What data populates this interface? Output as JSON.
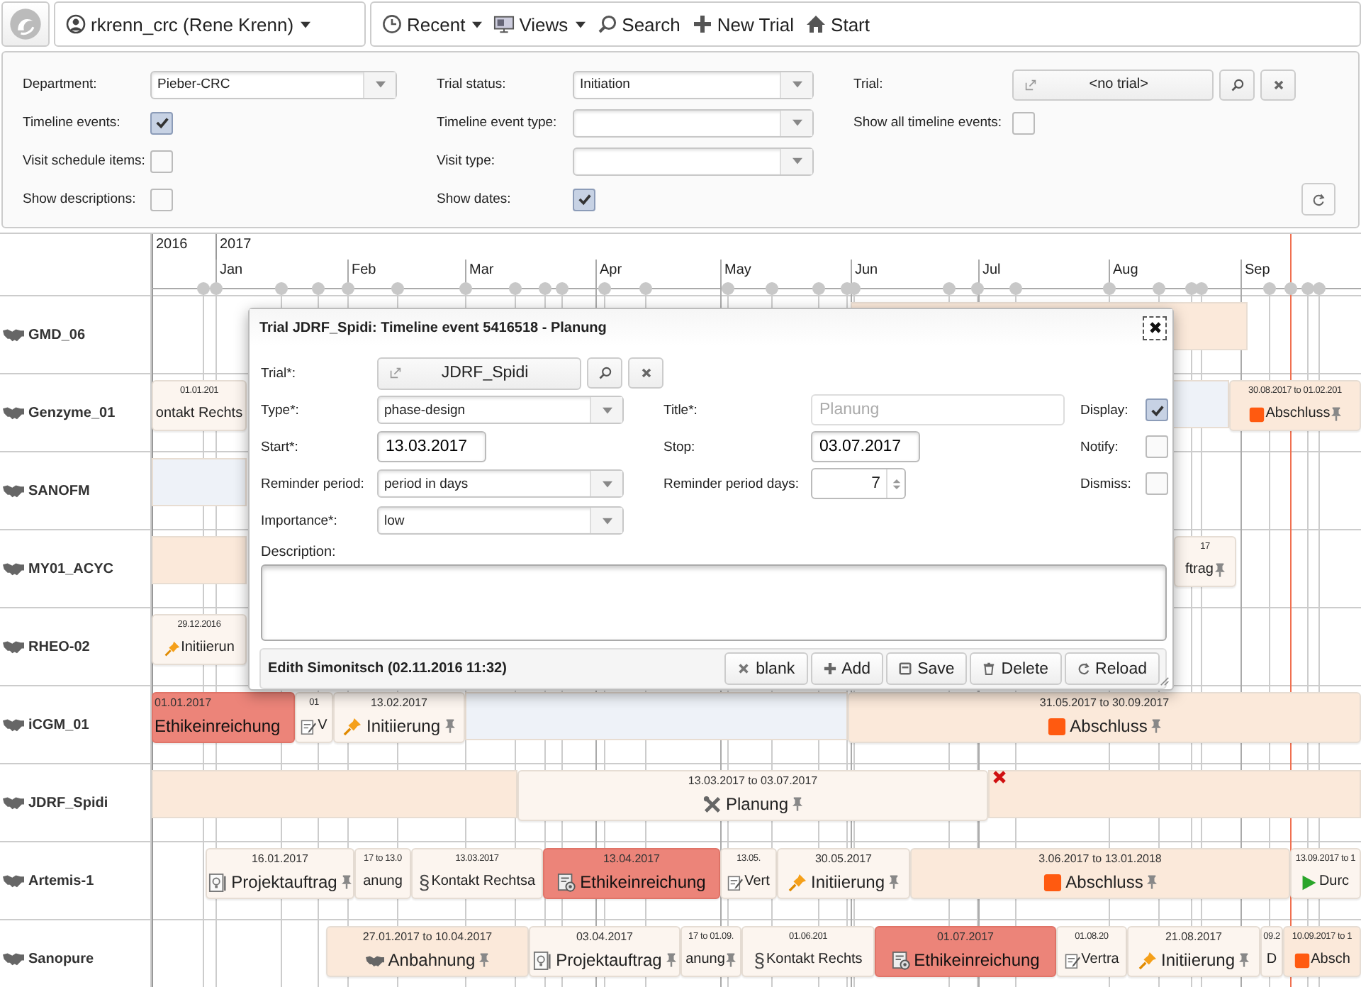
{
  "user_menu": {
    "label": "rkrenn_crc (Rene Krenn)"
  },
  "nav": [
    {
      "label": "Recent",
      "kind": "menu"
    },
    {
      "label": "Views",
      "kind": "menu"
    },
    {
      "label": "Search",
      "kind": "link"
    },
    {
      "label": "New Trial",
      "kind": "link"
    },
    {
      "label": "Start",
      "kind": "link"
    }
  ],
  "filter_columns": [
    [
      {
        "label": "Department:",
        "kind": "select",
        "value": "Pieber-CRC"
      },
      {
        "label": "Timeline events:",
        "kind": "checkbox",
        "checked": true
      },
      {
        "label": "Visit schedule items:",
        "kind": "checkbox",
        "checked": false
      },
      {
        "label": "Show descriptions:",
        "kind": "checkbox",
        "checked": false
      }
    ],
    [
      {
        "label": "Trial status:",
        "kind": "select",
        "value": "Initiation"
      },
      {
        "label": "Timeline event type:",
        "kind": "select"
      },
      {
        "label": "Visit type:",
        "kind": "select"
      },
      {
        "label": "Show dates:",
        "kind": "checkbox",
        "checked": true
      }
    ],
    [
      {
        "label": "Trial:",
        "kind": "lookup",
        "value": "<no trial>"
      },
      {
        "label": "Show all timeline events:",
        "kind": "checkbox",
        "checked": false
      }
    ]
  ],
  "timeline": {
    "years": [
      "2016",
      "2017"
    ],
    "months": [
      "Jan",
      "Feb",
      "Mar",
      "Apr",
      "May",
      "Jun",
      "Jul",
      "Aug",
      "Sep"
    ],
    "rows": [
      {
        "name": "GMD_06",
        "events": [
          {
            "kind": "bar",
            "color": "#fbe9da"
          }
        ]
      },
      {
        "name": "Genzyme_01",
        "events": [
          {
            "kind": "plain",
            "color": "#fcf5ef",
            "date": "01.01.201",
            "label": "ontakt Rechts",
            "pin": false
          },
          {
            "kind": "bar",
            "color": "#eef2f8"
          },
          {
            "kind": "square",
            "color": "#fbe9da",
            "date": "30.08.2017 to 01.02.201",
            "label": "Abschluss",
            "pin": true
          }
        ]
      },
      {
        "name": "SANOFM",
        "events": [
          {
            "kind": "bar",
            "color": "#eef2f8"
          }
        ]
      },
      {
        "name": "MY01_ACYC",
        "events": [
          {
            "kind": "bar",
            "color": "#fbe9da"
          },
          {
            "kind": "plain",
            "color": "#fcf5ef",
            "date": "17",
            "label": "ftrag",
            "pin": true
          }
        ]
      },
      {
        "name": "RHEO-02",
        "events": [
          {
            "kind": "pushpin",
            "color": "#fcf5ef",
            "date": "29.12.2016",
            "label": "Initiierun",
            "pin": false
          }
        ]
      },
      {
        "name": "iCGM_01",
        "events": [
          {
            "kind": "bar",
            "color": "#eef2f8"
          },
          {
            "kind": "plain",
            "color": "#ec8479",
            "date": "01.01.2017",
            "label": "Ethikeinreichung",
            "pin": false
          },
          {
            "kind": "note",
            "color": "#fcf5ef",
            "date": "01",
            "label": "V",
            "pin": false
          },
          {
            "kind": "pushpin",
            "color": "#fcf5ef",
            "date": "13.02.2017",
            "label": "Initiierung",
            "pin": true
          },
          {
            "kind": "square",
            "color": "#fbe9da",
            "date": "31.05.2017 to 30.09.2017",
            "label": "Abschluss",
            "pin": true
          }
        ]
      },
      {
        "name": "JDRF_Spidi",
        "events": [
          {
            "kind": "bar",
            "color": "#fbe9da"
          },
          {
            "kind": "tools",
            "color": "#fcf5ef",
            "date": "13.03.2017 to 03.07.2017",
            "label": "Planung",
            "pin": true
          },
          {
            "kind": "bar",
            "color": "#fbe9da"
          },
          {
            "kind": "marker"
          }
        ]
      },
      {
        "name": "Artemis-1",
        "events": [
          {
            "kind": "doc",
            "color": "#fcf5ef",
            "date": "16.01.2017",
            "label": "Projektauftrag",
            "pin": true
          },
          {
            "kind": "plain",
            "color": "#fcf5ef",
            "date": "17 to 13.0",
            "label": "anung",
            "pin": false
          },
          {
            "kind": "section",
            "color": "#fcf5ef",
            "glyph": "§",
            "date": "13.03.2017",
            "label": "Kontakt Rechtsa",
            "pin": false
          },
          {
            "kind": "ethics",
            "color": "#ec8479",
            "date": "13.04.2017",
            "label": "Ethikeinreichung",
            "pin": false
          },
          {
            "kind": "note",
            "color": "#fcf5ef",
            "date": "13.05.",
            "label": "Vert",
            "pin": false
          },
          {
            "kind": "pushpin",
            "color": "#fcf5ef",
            "date": "30.05.2017",
            "label": "Initiierung",
            "pin": true
          },
          {
            "kind": "square",
            "color": "#fbe9da",
            "date": "3.06.2017 to 13.01.2018",
            "label": "Abschluss",
            "pin": true
          },
          {
            "kind": "play",
            "color": "#fcf5ef",
            "date": "13.09.2017 to 1",
            "label": "Durc",
            "pin": false
          }
        ]
      },
      {
        "name": "Sanopure",
        "events": [
          {
            "kind": "handshake",
            "color": "#fbe9da",
            "date": "27.01.2017 to 10.04.2017",
            "label": "Anbahnung",
            "pin": true
          },
          {
            "kind": "doc",
            "color": "#fcf5ef",
            "date": "03.04.2017",
            "label": "Projektauftrag",
            "pin": true
          },
          {
            "kind": "plain",
            "color": "#fcf5ef",
            "date": "17 to 01.09.",
            "label": "anung",
            "pin": true
          },
          {
            "kind": "section",
            "color": "#fcf5ef",
            "glyph": "§",
            "date": "01.06.201",
            "label": "Kontakt Rechts",
            "pin": false
          },
          {
            "kind": "ethics",
            "color": "#ec8479",
            "date": "01.07.2017",
            "label": "Ethikeinreichung",
            "pin": false
          },
          {
            "kind": "note",
            "color": "#fcf5ef",
            "date": "01.08.20",
            "label": "Vertra",
            "pin": false
          },
          {
            "kind": "pushpin",
            "color": "#fcf5ef",
            "date": "21.08.2017",
            "label": "Initiierung",
            "pin": true
          },
          {
            "kind": "plain",
            "color": "#fcf5ef",
            "date": "09.2",
            "label": "D",
            "pin": false
          },
          {
            "kind": "square",
            "color": "#fbe9da",
            "date": "10.09.2017 to 1",
            "label": "Absch",
            "pin": false
          }
        ]
      }
    ]
  },
  "dialog": {
    "title": "Trial JDRF_Spidi: Timeline event 5416518 - Planung",
    "left_fields": [
      {
        "label": "Trial*:",
        "kind": "lookup",
        "value": "JDRF_Spidi"
      },
      {
        "label": "Type*:",
        "kind": "select",
        "value": "phase-design"
      },
      {
        "label": "Start*:",
        "kind": "date",
        "value": "13.03.2017"
      },
      {
        "label": "Reminder period:",
        "kind": "select",
        "value": "period in days"
      },
      {
        "label": "Importance*:",
        "kind": "select",
        "value": "low"
      }
    ],
    "middle_fields": [
      {
        "label": "Title*:",
        "kind": "text",
        "placeholder": "Planung"
      },
      {
        "label": "Stop:",
        "kind": "date",
        "value": "03.07.2017"
      },
      {
        "label": "Reminder period days:",
        "kind": "spinner",
        "value": "7"
      }
    ],
    "right_fields": [
      {
        "label": "Display:",
        "checked": true
      },
      {
        "label": "Notify:",
        "checked": false
      },
      {
        "label": "Dismiss:",
        "checked": false
      }
    ],
    "description_label": "Description:",
    "author": "Edith Simonitsch (02.11.2016 11:32)",
    "buttons": [
      "blank",
      "Add",
      "Save",
      "Delete",
      "Reload"
    ]
  }
}
